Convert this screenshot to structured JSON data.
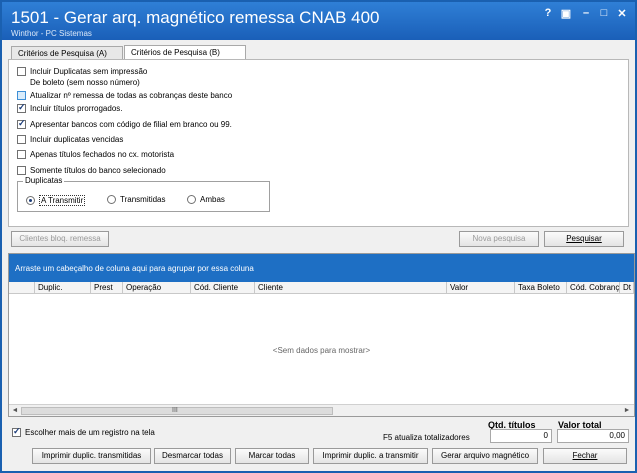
{
  "window": {
    "title": "1501 - Gerar arq. magnético remessa CNAB 400",
    "subtitle": "Winthor - PC Sistemas",
    "controls": {
      "help": "?",
      "restore": "▣",
      "minimize": "–",
      "maximize": "□",
      "close": "✕"
    }
  },
  "tabs": [
    {
      "label": "Critérios de Pesquisa (A)"
    },
    {
      "label": "Critérios de Pesquisa (B)"
    }
  ],
  "options": [
    {
      "label1": "Incluir Duplicatas sem impressão",
      "label2": "De boleto (sem nosso número)",
      "checked": false
    },
    {
      "label1": "Atualizar nº remessa de todas as cobranças deste banco",
      "checked": false,
      "highlight": true
    },
    {
      "label1": "Incluir títulos prorrogados.",
      "checked": true
    },
    {
      "label1": "Apresentar bancos com código de filial em branco ou 99.",
      "checked": true
    },
    {
      "label1": "Incluir duplicatas vencidas",
      "checked": false
    },
    {
      "label1": "Apenas títulos fechados no cx. motorista",
      "checked": false
    },
    {
      "label1": "Somente títulos do banco selecionado",
      "checked": false
    }
  ],
  "duplicatas": {
    "legend": "Duplicatas",
    "options": [
      {
        "label": "A Transmitir",
        "selected": true
      },
      {
        "label": "Transmitidas",
        "selected": false
      },
      {
        "label": "Ambas",
        "selected": false
      }
    ]
  },
  "buttons": {
    "clientes_bloq": "Clientes bloq. remessa",
    "nova_pesquisa": "Nova pesquisa",
    "pesquisar": "Pesquisar"
  },
  "grid": {
    "group_hint": "Arraste um cabeçalho de coluna aqui para agrupar por essa coluna",
    "columns": [
      "Duplic.",
      "Prest",
      "Operação",
      "Cód. Cliente",
      "Cliente",
      "Valor",
      "Taxa Boleto",
      "Cód. Cobrança",
      "Dt"
    ],
    "empty_message": "<Sem dados para mostrar>",
    "scroll_grip": "III"
  },
  "footer": {
    "choose_multiple": "Escolher mais de um registro na tela",
    "choose_multiple_checked": true,
    "qtd_titulos_label": "Qtd. títulos",
    "valor_total_label": "Valor total",
    "f5_label": "F5 atualiza totalizadores",
    "qtd_titulos_value": "0",
    "valor_total_value": "0,00"
  },
  "actions": [
    "Imprimir duplic. transmitidas",
    "Desmarcar todas",
    "Marcar todas",
    "Imprimir duplic. a transmitir",
    "Gerar arquivo magnético",
    "Fechar"
  ],
  "colors": {
    "title_bar": "#1a5fb8",
    "group_bar": "#1e6fc4",
    "window_border": "#1a60b0"
  }
}
